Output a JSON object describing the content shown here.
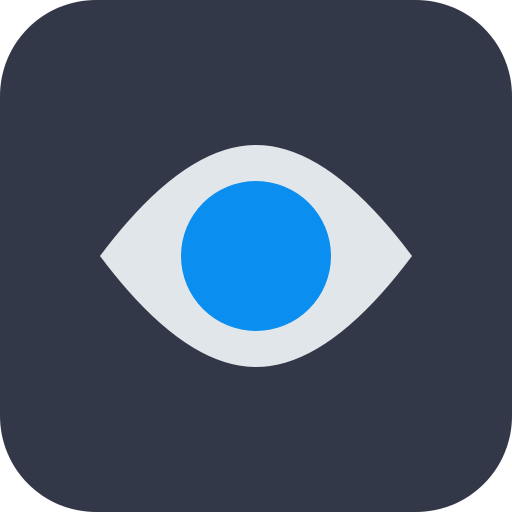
{
  "icon": {
    "name": "eye-icon",
    "colors": {
      "background": "#333848",
      "eye_white": "#E1E6EA",
      "iris": "#0A8FF0"
    }
  }
}
